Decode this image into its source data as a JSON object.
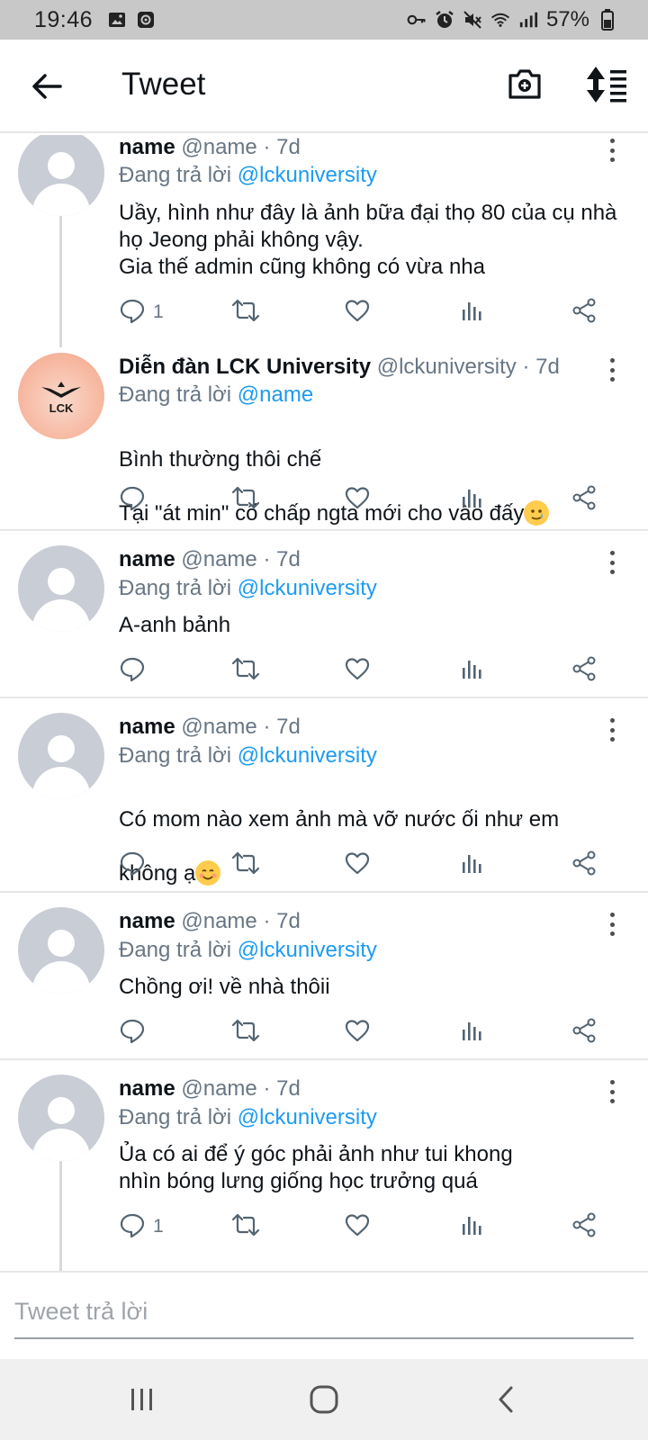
{
  "status_bar": {
    "time": "19:46",
    "battery_pct": "57%",
    "left_icons": [
      "gallery-icon",
      "app-notification-icon"
    ],
    "right_icons": [
      "vpn-key-icon",
      "alarm-icon",
      "mute-icon",
      "wifi-icon",
      "signal-icon",
      "battery-icon"
    ]
  },
  "header": {
    "title": "Tweet",
    "icons": [
      "back-arrow-icon",
      "camera-icon",
      "sort-icon"
    ]
  },
  "tweets": [
    {
      "name": "name",
      "handle": "@name · 7d",
      "reply_prefix": "Đang trả lời",
      "reply_to": "@lckuniversity",
      "text": "Uầy, hình như đây là ảnh bữa đại thọ 80 của cụ nhà họ Jeong phải không vậy.\nGia thế admin cũng không có vừa nha",
      "reply_count": "1"
    },
    {
      "name": "Diễn đàn LCK University",
      "handle": "@lckuniversity · 7d",
      "reply_prefix": "Đang trả lời",
      "reply_to": "@name",
      "text_line1": "Bình thường thôi chế",
      "text_line2": "Tại \"át min\" cố chấp ngta mới cho vào đấy",
      "reply_count": "",
      "avatar_logo_text": "LCK"
    },
    {
      "name": "name",
      "handle": "@name · 7d",
      "reply_prefix": "Đang trả lời",
      "reply_to": "@lckuniversity",
      "text": "A-anh bảnh",
      "reply_count": ""
    },
    {
      "name": "name",
      "handle": "@name · 7d",
      "reply_prefix": "Đang trả lời",
      "reply_to": "@lckuniversity",
      "text_line1": "Có mom nào xem ảnh mà vỡ nước ối như em",
      "text_line2": "không ạ",
      "reply_count": ""
    },
    {
      "name": "name",
      "handle": "@name · 7d",
      "reply_prefix": "Đang trả lời",
      "reply_to": "@lckuniversity",
      "text": "Chồng ơi! về nhà thôii",
      "reply_count": ""
    },
    {
      "name": "name",
      "handle": "@name · 7d",
      "reply_prefix": "Đang trả lời",
      "reply_to": "@lckuniversity",
      "text": "Ủa có ai để ý góc phải ảnh như tui khong\nnhìn bóng lưng giống học trưởng quá",
      "reply_count": "1"
    }
  ],
  "action_icons": [
    "reply-icon",
    "retweet-icon",
    "like-icon",
    "analytics-icon",
    "share-icon"
  ],
  "reply_bar": {
    "placeholder": "Tweet trả lời"
  },
  "nav_bar": {
    "icons": [
      "recent-apps-icon",
      "home-icon",
      "back-icon"
    ]
  },
  "colors": {
    "link": "#1d9bf0",
    "muted": "#687684",
    "text": "#0f1419",
    "status_bar_bg": "#c8c8c8"
  }
}
